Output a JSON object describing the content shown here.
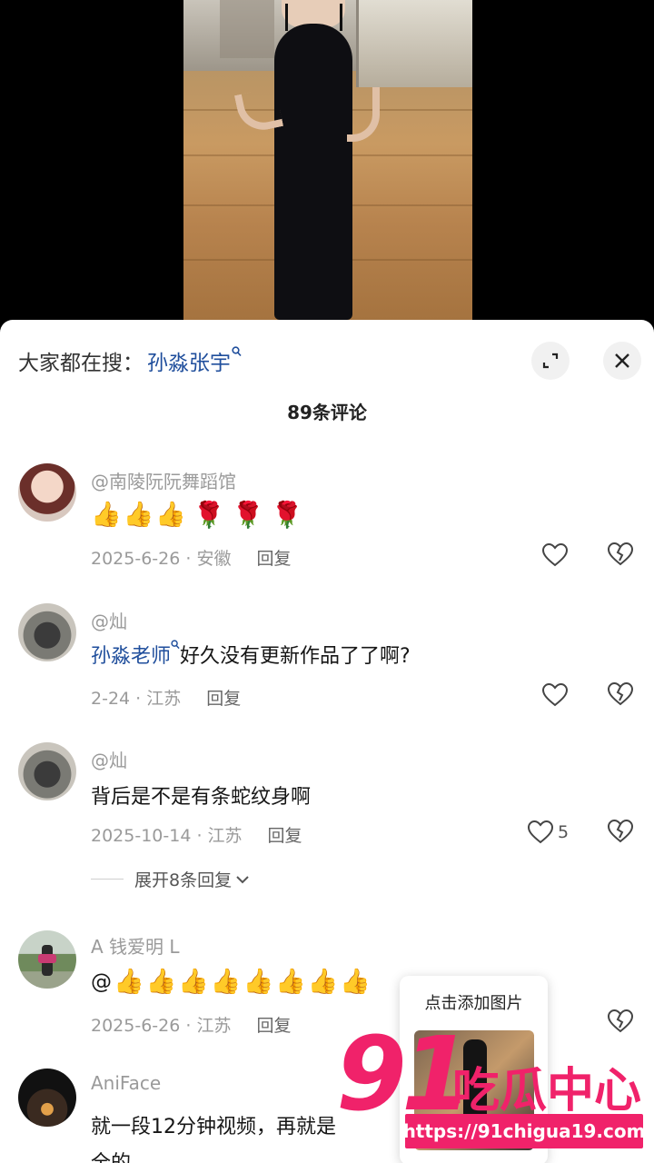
{
  "search_hint": {
    "prefix": "大家都在搜：",
    "term": "孙淼张宇"
  },
  "comments_count": "89条评论",
  "comments": [
    {
      "username": "@南陵阮阮舞蹈馆",
      "text": "",
      "emojis": [
        "thumbs-up",
        "thumbs-up",
        "thumbs-up",
        "rose",
        "rose",
        "rose"
      ],
      "date_location": "2025-6-26 · 安徽",
      "reply": "回复",
      "likes": ""
    },
    {
      "username": "@灿",
      "mention": "孙淼老师",
      "text": "好久没有更新作品了了啊?",
      "date_location": "2-24 · 江苏",
      "reply": "回复",
      "likes": ""
    },
    {
      "username": "@灿",
      "text": "背后是不是有条蛇纹身啊",
      "date_location": "2025-10-14 · 江苏",
      "reply": "回复",
      "likes": "5"
    },
    {
      "username": "A 钱爱明 L",
      "text": "@",
      "emojis": [
        "thumbs-up",
        "thumbs-up",
        "thumbs-up",
        "thumbs-up",
        "thumbs-up",
        "thumbs-up",
        "thumbs-up",
        "thumbs-up"
      ],
      "date_location": "2025-6-26 · 江苏",
      "reply": "回复",
      "likes": ""
    },
    {
      "username": "AniFace",
      "text": "就一段12分钟视频，再就是",
      "text_line2": "全的"
    }
  ],
  "expand_replies": "展开8条回复",
  "add_image_popup": {
    "label": "点击添加图片"
  },
  "watermark": {
    "number": "91",
    "word": "吃瓜中心",
    "url": "https://91chigua19.com"
  },
  "colors": {
    "accent_link": "#1f4e9c",
    "watermark": "#f0226a",
    "meta_gray": "#9a9a9a"
  }
}
